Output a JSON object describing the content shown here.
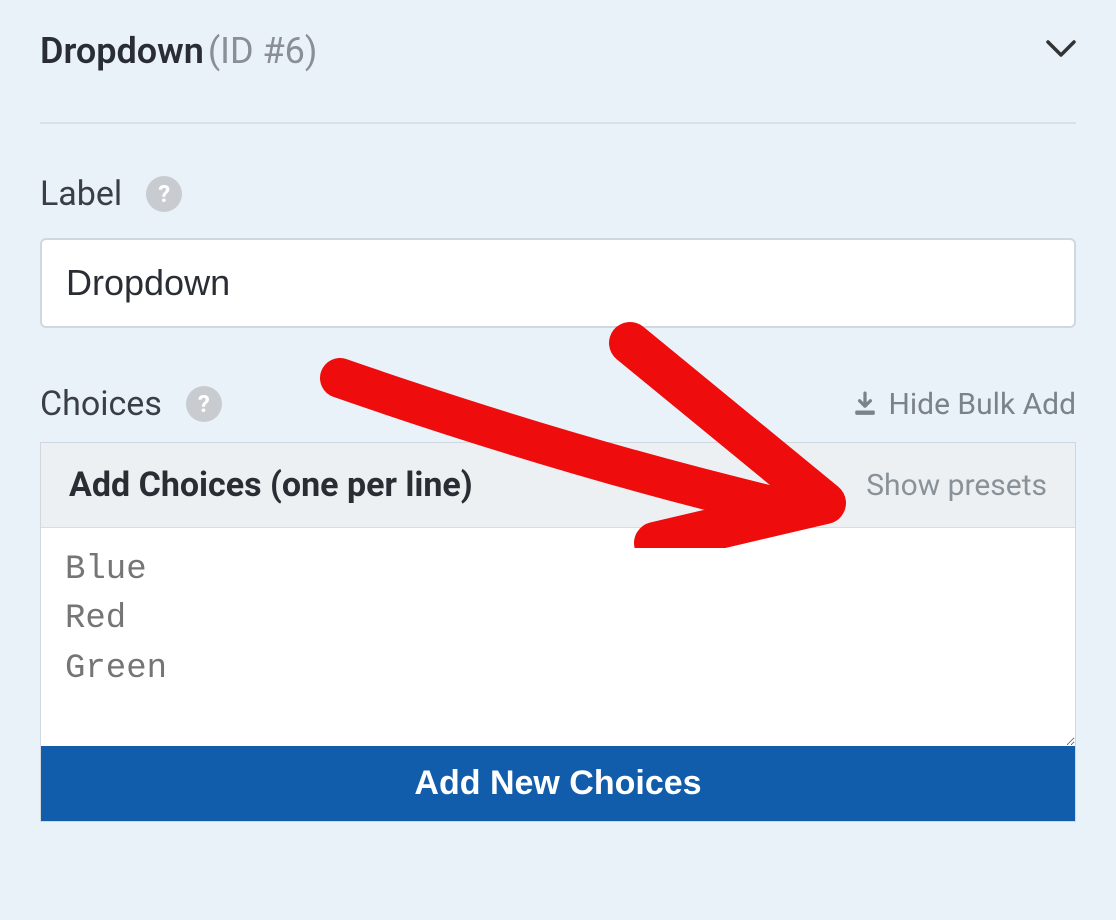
{
  "panel": {
    "title": "Dropdown",
    "id_label": "(ID #6)"
  },
  "label_section": {
    "heading": "Label",
    "value": "Dropdown"
  },
  "choices_section": {
    "heading": "Choices",
    "bulk_toggle": "Hide Bulk Add",
    "bulk_title": "Add Choices (one per line)",
    "presets_link": "Show presets",
    "placeholder": "Blue\nRed\nGreen",
    "button_label": "Add New Choices"
  },
  "icons": {
    "help": "?",
    "download": "download-icon",
    "chevron": "chevron-down-icon"
  }
}
